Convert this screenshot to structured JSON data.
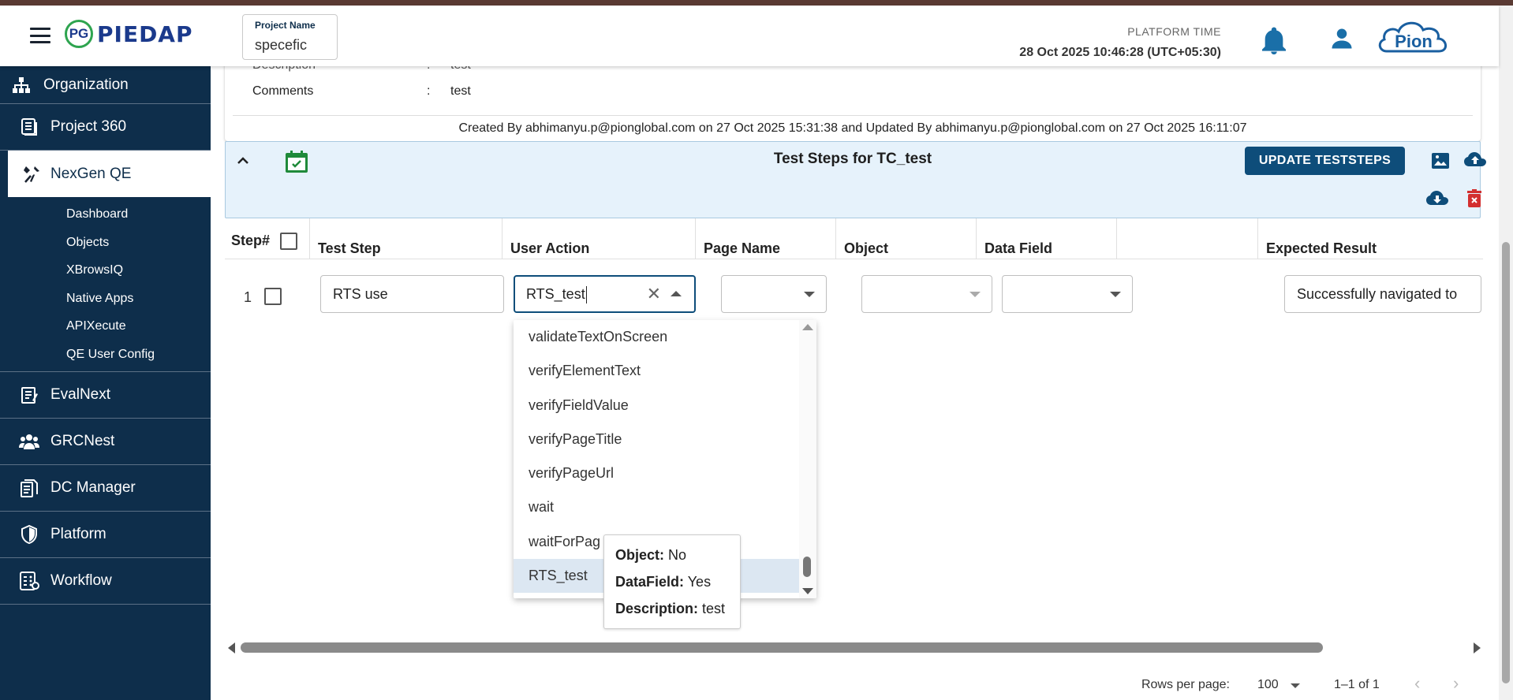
{
  "header": {
    "app_name": "PIEDAP",
    "logo_mark": "PG",
    "project_label": "Project Name",
    "project_value": "specefic",
    "platform_time_label": "PLATFORM TIME",
    "platform_time_value": "28 Oct 2025 10:46:28 (UTC+05:30)",
    "brand_logo": "Pion"
  },
  "sidebar": {
    "items": [
      {
        "label": "Organization",
        "icon": "org-chart-icon"
      },
      {
        "label": "Project 360",
        "icon": "document-list-icon"
      },
      {
        "label": "NexGen QE",
        "icon": "tools-icon"
      },
      {
        "label": "EvalNext",
        "icon": "clipboard-icon"
      },
      {
        "label": "GRCNest",
        "icon": "people-group-icon"
      },
      {
        "label": "DC Manager",
        "icon": "documents-icon"
      },
      {
        "label": "Platform",
        "icon": "shield-icon"
      },
      {
        "label": "Workflow",
        "icon": "workflow-icon"
      }
    ],
    "subitems": [
      "Dashboard",
      "Objects",
      "XBrowsIQ",
      "Native Apps",
      "APIXecute",
      "QE User Config"
    ]
  },
  "info": {
    "description_label": "Description",
    "description_value": "test",
    "comments_label": "Comments",
    "comments_value": "test",
    "created_text": "Created By abhimanyu.p@pionglobal.com on 27 Oct 2025 15:31:38 and Updated By abhimanyu.p@pionglobal.com on 27 Oct 2025 16:11:07"
  },
  "steps": {
    "title": "Test Steps for TC_test",
    "update_label": "UPDATE TESTSTEPS"
  },
  "table": {
    "headers": {
      "step": "Step#",
      "test_step": "Test Step",
      "user_action": "User Action",
      "page_name": "Page Name",
      "object": "Object",
      "data_field": "Data Field",
      "blank": "",
      "expected": "Expected Result"
    },
    "row": {
      "num": "1",
      "test_step": "RTS use",
      "user_action": "RTS_test",
      "page_name": "",
      "object": "",
      "data_field": "",
      "expected": "Successfully navigated to"
    }
  },
  "dropdown": {
    "options": [
      "validateTextOnScreen",
      "verifyElementText",
      "verifyFieldValue",
      "verifyPageTitle",
      "verifyPageUrl",
      "wait",
      "waitForPag",
      "RTS_test"
    ],
    "selected_index": 7
  },
  "tooltip": {
    "object_label": "Object:",
    "object_value": "No",
    "datafield_label": "DataField:",
    "datafield_value": "Yes",
    "description_label": "Description:",
    "description_value": "test"
  },
  "pagination": {
    "rows_label": "Rows per page:",
    "rows_value": "100",
    "range": "1–1 of 1"
  },
  "colors": {
    "sidebar_bg": "#0e2e4b",
    "primary": "#0e4d7a",
    "steps_header_bg": "#e6f2fb",
    "delete": "#d32f2f",
    "calendar_green": "#1f8a3a"
  }
}
